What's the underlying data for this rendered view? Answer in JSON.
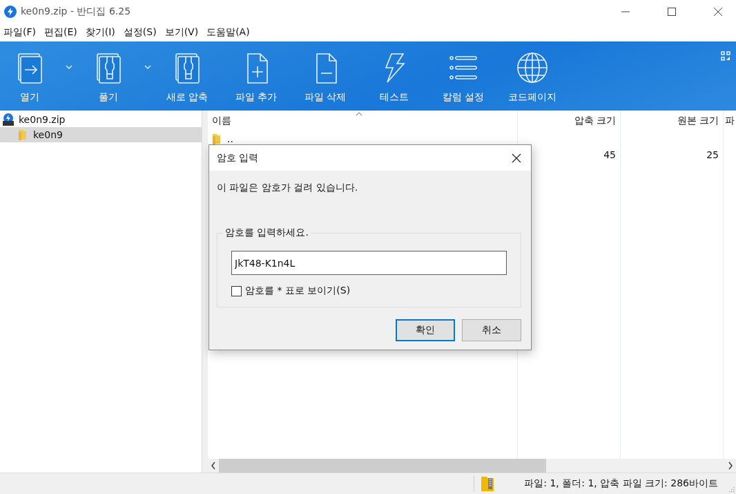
{
  "window": {
    "title": "ke0n9.zip - 반디집 6.25"
  },
  "menu": [
    "파일(F)",
    "편집(E)",
    "찾기(I)",
    "설정(S)",
    "보기(V)",
    "도움말(A)"
  ],
  "toolbar": [
    {
      "kind": "open",
      "label": "열기",
      "dropdown": true
    },
    {
      "kind": "extract",
      "label": "풀기",
      "dropdown": true
    },
    {
      "kind": "new",
      "label": "새로 압축",
      "dropdown": false
    },
    {
      "kind": "add",
      "label": "파일 추가",
      "dropdown": false
    },
    {
      "kind": "delete",
      "label": "파일 삭제",
      "dropdown": false
    },
    {
      "kind": "test",
      "label": "테스트",
      "dropdown": false
    },
    {
      "kind": "columns",
      "label": "칼럼 설정",
      "dropdown": false
    },
    {
      "kind": "codepage",
      "label": "코드페이지",
      "dropdown": false
    }
  ],
  "tree": [
    {
      "kind": "zip",
      "label": "ke0n9.zip",
      "selected": false,
      "children": [
        {
          "kind": "folder",
          "label": "ke0n9",
          "selected": true
        }
      ]
    }
  ],
  "file_list": {
    "columns": [
      "이름",
      "압축 크기",
      "원본 크기",
      "파"
    ],
    "rows": [
      {
        "kind": "folder",
        "name": ".."
      },
      {
        "kind": "file",
        "compressed_size": "45",
        "original_size": "25"
      }
    ]
  },
  "dialog": {
    "title": "암호 입력",
    "message": "이 파일은 암호가 걸려 있습니다.",
    "group_label": "암호를 입력하세요.",
    "password": "JkT48-K1n4L",
    "mask_option": {
      "label": "암호를 * 표로 보이기(S)",
      "checked": false
    },
    "buttons": [
      {
        "label": "확인",
        "default": true
      },
      {
        "label": "취소",
        "default": false
      }
    ]
  },
  "status_bar": {
    "text": "파일: 1, 폴더: 1, 압축 파일 크기: 286바이트"
  }
}
